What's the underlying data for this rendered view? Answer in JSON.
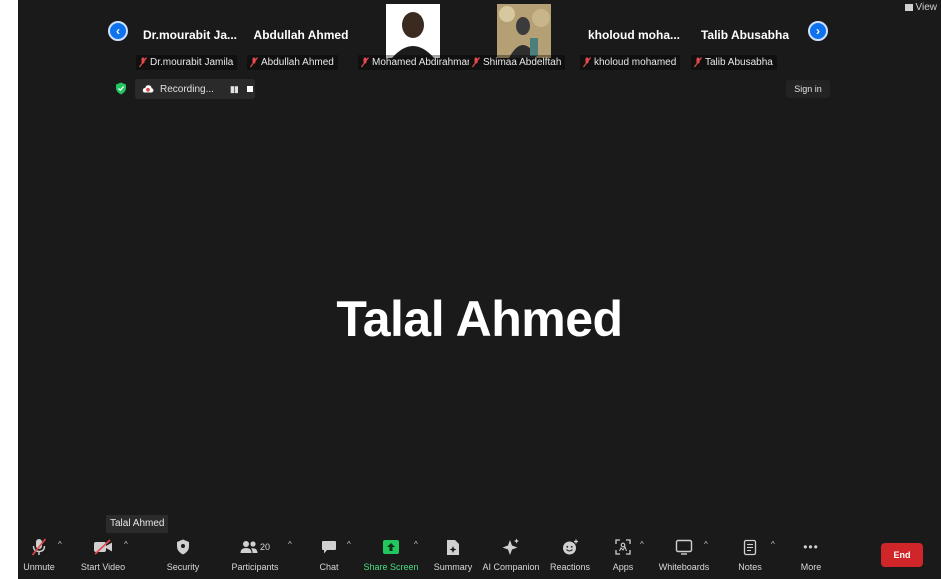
{
  "gallery": {
    "prev_label": "‹",
    "next_label": "›",
    "tiles": [
      {
        "big_name": "Dr.mourabit  Ja...",
        "tag": "Dr.mourabit Jamila"
      },
      {
        "big_name": "Abdullah Ahmed",
        "tag": "Abdullah Ahmed"
      },
      {
        "big_name": "",
        "tag": "Mohamed Abdirahman"
      },
      {
        "big_name": "",
        "tag": "Shimaa Abdelftah"
      },
      {
        "big_name": "kholoud  moha...",
        "tag": "kholoud mohamed"
      },
      {
        "big_name": "Talib Abusabha",
        "tag": "Talib Abusabha"
      }
    ]
  },
  "top_right": {
    "view_label": "View"
  },
  "recording": {
    "label": "Recording...",
    "pause_symbol": "▮▮"
  },
  "sign_in_label": "Sign in",
  "main": {
    "speaker_name": "Talal Ahmed"
  },
  "tooltip": {
    "text": "Talal Ahmed"
  },
  "toolbar": {
    "unmute": "Unmute",
    "start_video": "Start Video",
    "security": "Security",
    "participants": "Participants",
    "participants_count": "20",
    "chat": "Chat",
    "share_screen": "Share Screen",
    "summary": "Summary",
    "ai_companion": "AI Companion",
    "reactions": "Reactions",
    "apps": "Apps",
    "whiteboards": "Whiteboards",
    "notes": "Notes",
    "more": "More",
    "more_glyph": "•••",
    "end": "End"
  },
  "colors": {
    "background": "#1a1a1a",
    "accent_blue": "#0e72ed",
    "share_green": "#22c55e",
    "end_red": "#d0262a",
    "muted_red": "#e5484d"
  }
}
